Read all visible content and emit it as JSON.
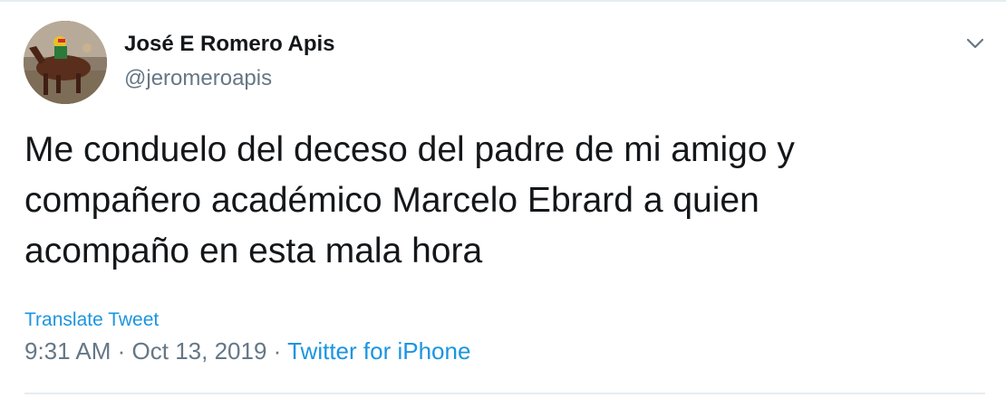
{
  "author": {
    "display_name": "José E Romero Apis",
    "handle": "@jeromeroapis"
  },
  "tweet": {
    "text_lines": [
      "Me conduelo del deceso del padre de mi amigo y",
      "compañero académico Marcelo Ebrard a quien",
      "acompaño en esta mala hora"
    ],
    "translate_label": "Translate Tweet",
    "time": "9:31 AM",
    "separator": "·",
    "date": "Oct 13, 2019",
    "source": "Twitter for iPhone"
  },
  "icons": {
    "menu": "chevron-down-icon",
    "avatar": "avatar"
  },
  "colors": {
    "text": "#14171a",
    "secondary": "#657786",
    "link": "#1b95e0",
    "border": "#e6ecf0"
  }
}
